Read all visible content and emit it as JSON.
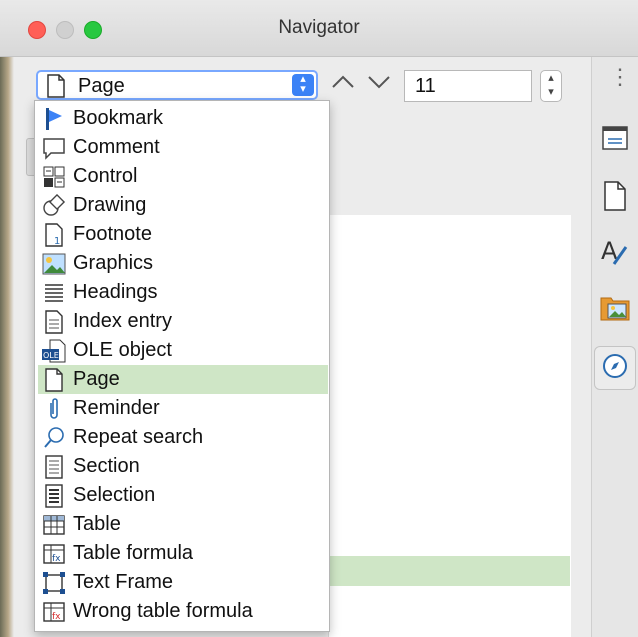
{
  "window": {
    "title": "Navigator"
  },
  "toolbar": {
    "navigate_by_selected": "Page",
    "page_number": "11"
  },
  "dropdown": {
    "selected": "Page",
    "items": [
      {
        "label": "Bookmark",
        "icon": "bookmark-icon"
      },
      {
        "label": "Comment",
        "icon": "comment-icon"
      },
      {
        "label": "Control",
        "icon": "control-icon"
      },
      {
        "label": "Drawing",
        "icon": "drawing-icon"
      },
      {
        "label": "Footnote",
        "icon": "footnote-icon"
      },
      {
        "label": "Graphics",
        "icon": "graphics-icon"
      },
      {
        "label": "Headings",
        "icon": "headings-icon"
      },
      {
        "label": "Index entry",
        "icon": "index-entry-icon"
      },
      {
        "label": "OLE object",
        "icon": "ole-object-icon"
      },
      {
        "label": "Page",
        "icon": "page-icon"
      },
      {
        "label": "Reminder",
        "icon": "reminder-icon"
      },
      {
        "label": "Repeat search",
        "icon": "repeat-search-icon"
      },
      {
        "label": "Section",
        "icon": "section-icon"
      },
      {
        "label": "Selection",
        "icon": "selection-icon"
      },
      {
        "label": "Table",
        "icon": "table-icon"
      },
      {
        "label": "Table formula",
        "icon": "table-formula-icon"
      },
      {
        "label": "Text Frame",
        "icon": "text-frame-icon"
      },
      {
        "label": "Wrong table formula",
        "icon": "wrong-table-formula-icon"
      }
    ]
  },
  "sidebar": {
    "icons": [
      "properties-icon",
      "page-icon",
      "styles-icon",
      "gallery-icon",
      "navigator-icon"
    ]
  },
  "colors": {
    "selection_green": "#cfe6c6",
    "focus_blue": "#79a8ff",
    "close": "#ff5f57",
    "zoom": "#28c840"
  }
}
